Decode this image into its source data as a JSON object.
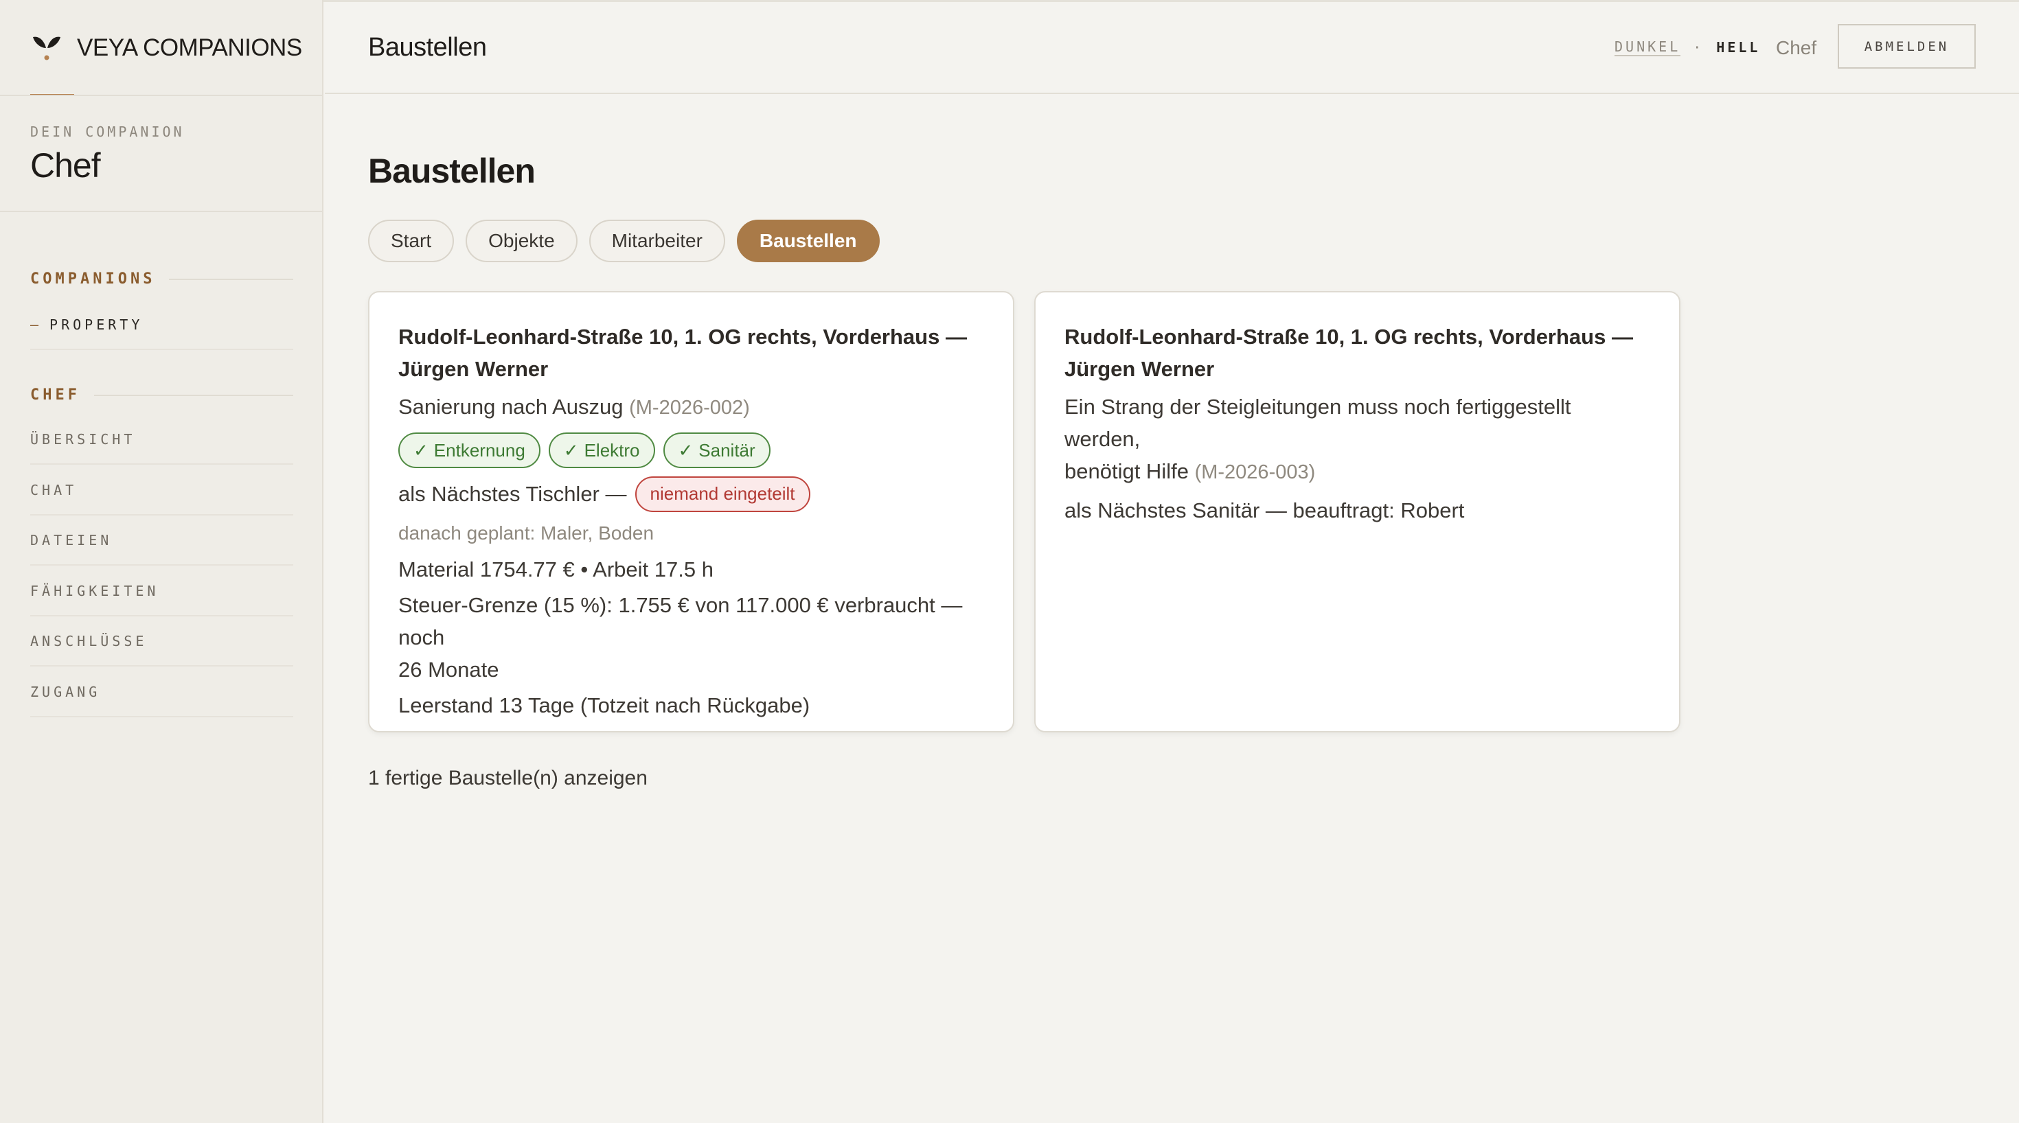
{
  "brand": {
    "name": "VEYA COMPANIONS",
    "icon": "veya-leaf-icon",
    "accent": "#b58150"
  },
  "companion": {
    "eyebrow": "DEIN COMPANION",
    "name": "Chef"
  },
  "sidebar": {
    "companions_heading": "COMPANIONS",
    "companions_items": [
      {
        "dash": "—",
        "label": "PROPERTY"
      }
    ],
    "chef_heading": "CHEF",
    "chef_items": [
      {
        "label": "ÜBERSICHT"
      },
      {
        "label": "CHAT"
      },
      {
        "label": "DATEIEN"
      },
      {
        "label": "FÄHIGKEITEN"
      },
      {
        "label": "ANSCHLÜSSE"
      },
      {
        "label": "ZUGANG"
      }
    ]
  },
  "header": {
    "title": "Baustellen",
    "theme_dark": "DUNKEL",
    "theme_separator": "·",
    "theme_light": "HELL",
    "user": "Chef",
    "logout": "ABMELDEN"
  },
  "main": {
    "title": "Baustellen",
    "tabs": [
      {
        "label": "Start",
        "active": false
      },
      {
        "label": "Objekte",
        "active": false
      },
      {
        "label": "Mitarbeiter",
        "active": false
      },
      {
        "label": "Baustellen",
        "active": true
      }
    ],
    "cards": [
      {
        "title_line1": "Rudolf-Leonhard-Straße 10, 1. OG rechts, Vorderhaus —",
        "title_line2": "Jürgen Werner",
        "description": "Sanierung nach Auszug",
        "code": "(M-2026-002)",
        "done_trades": [
          {
            "check": "✓",
            "label": "Entkernung"
          },
          {
            "check": "✓",
            "label": "Elektro"
          },
          {
            "check": "✓",
            "label": "Sanitär"
          }
        ],
        "next_text": "als Nächstes Tischler —",
        "next_badge": "niemand eingeteilt",
        "planned": "danach geplant: Maler, Boden",
        "cost": "Material 1754.77 € • Arbeit 17.5 h",
        "tax_line1": "Steuer-Grenze (15 %): 1.755 € von 117.000 € verbraucht — noch",
        "tax_line2": "26 Monate",
        "vacancy": "Leerstand 13 Tage (Totzeit nach Rückgabe)"
      },
      {
        "title_line1": "Rudolf-Leonhard-Straße 10, 1. OG rechts, Vorderhaus —",
        "title_line2": "Jürgen Werner",
        "description_line1": "Ein Strang der Steigleitungen muss noch fertiggestellt werden,",
        "description_line2": "benötigt Hilfe",
        "code": "(M-2026-003)",
        "next_text": "als Nächstes Sanitär — beauftragt: Robert"
      }
    ],
    "show_finished": "1 fertige Baustelle(n) anzeigen"
  },
  "colors": {
    "background": "#f4f3ef",
    "accent_brown": "#a97a48",
    "success_green": "#4f8a42",
    "danger_red": "#c0453e"
  }
}
